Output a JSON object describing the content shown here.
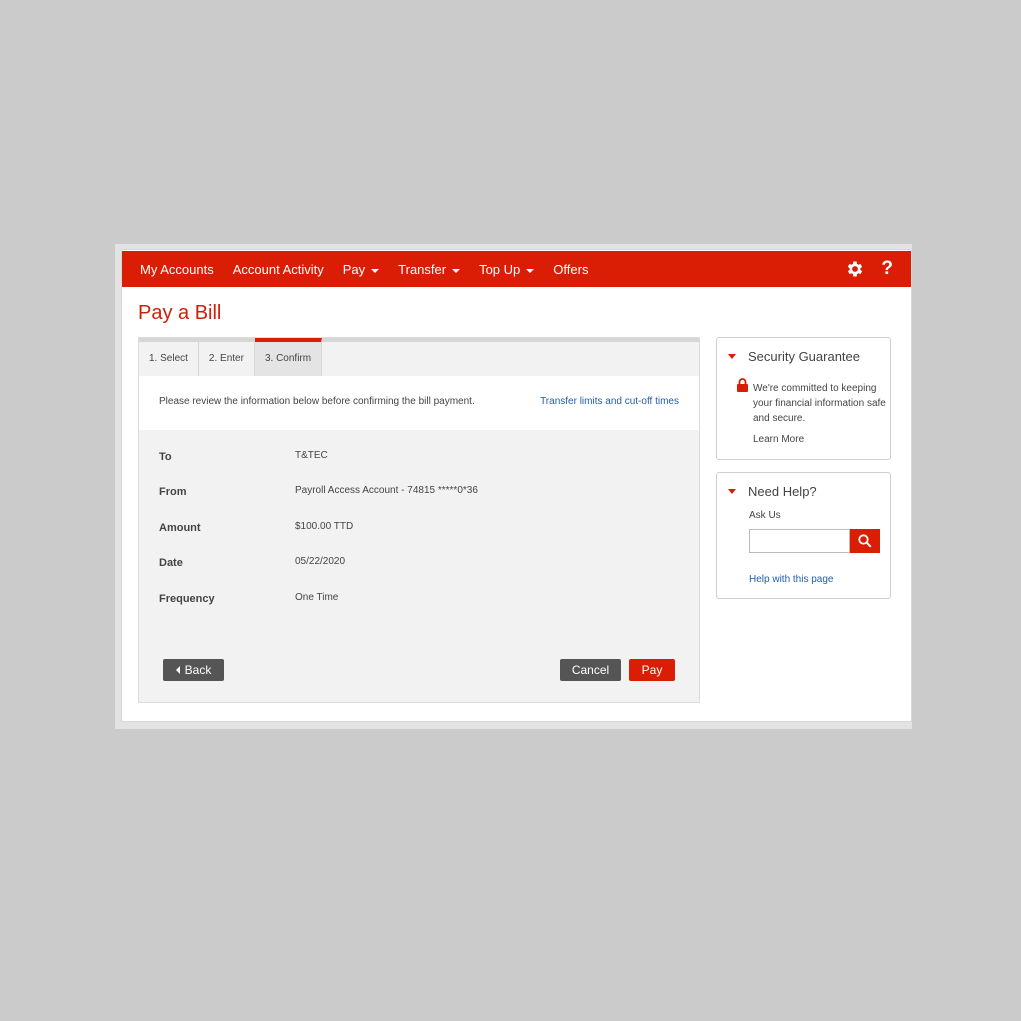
{
  "nav": {
    "items": [
      {
        "label": "My Accounts",
        "dropdown": false
      },
      {
        "label": "Account Activity",
        "dropdown": false
      },
      {
        "label": "Pay",
        "dropdown": true
      },
      {
        "label": "Transfer",
        "dropdown": true
      },
      {
        "label": "Top Up",
        "dropdown": true
      },
      {
        "label": "Offers",
        "dropdown": false
      }
    ],
    "settings_icon": "gear-icon",
    "help_label": "?"
  },
  "page": {
    "title": "Pay a Bill"
  },
  "steps": [
    {
      "label": "1. Select",
      "active": false
    },
    {
      "label": "2. Enter",
      "active": false
    },
    {
      "label": "3. Confirm",
      "active": true
    }
  ],
  "notice": {
    "text": "Please review the information below before confirming the bill payment.",
    "link": "Transfer limits and cut-off times"
  },
  "details": [
    {
      "label": "To",
      "value": "T&TEC"
    },
    {
      "label": "From",
      "value": "Payroll Access Account - 74815 *****0*36"
    },
    {
      "label": "Amount",
      "value": "$100.00 TTD"
    },
    {
      "label": "Date",
      "value": "05/22/2020"
    },
    {
      "label": "Frequency",
      "value": "One Time"
    }
  ],
  "buttons": {
    "back": "Back",
    "cancel": "Cancel",
    "pay": "Pay"
  },
  "security": {
    "title": "Security Guarantee",
    "text": "We're committed to keeping your financial information safe and secure.",
    "link": "Learn More"
  },
  "help": {
    "title": "Need Help?",
    "ask_label": "Ask Us",
    "search_value": "",
    "link": "Help with this page"
  },
  "colors": {
    "brand": "#d91e05",
    "link": "#1f5fa8",
    "button_dark": "#555555"
  }
}
